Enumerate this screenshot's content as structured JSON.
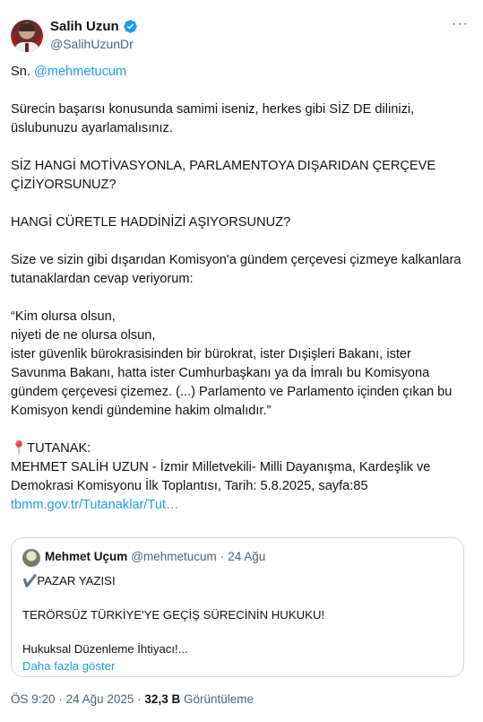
{
  "author": {
    "display_name": "Salih Uzun",
    "handle": "@SalihUzunDr",
    "more_icon": "···"
  },
  "tweet": {
    "salutation_prefix": "Sn. ",
    "salutation_mention": "@mehmetucum",
    "p1": "Sürecin başarısı konusunda samimi iseniz, herkes gibi SİZ DE dilinizi, üslubunuzu ayarlamalısınız.",
    "p2": "SİZ HANGİ MOTİVASYONLA, PARLAMENTOYA DIŞARIDAN ÇERÇEVE ÇİZİYORSUNUZ?",
    "p3": "HANGİ CÜRETLE HADDİNİZİ AŞIYORSUNUZ?",
    "p4": "Size ve sizin gibi dışarıdan Komisyon'a gündem çerçevesi çizmeye kalkanlara tutanaklardan cevap veriyorum:",
    "quote_l1": "“Kim olursa olsun,",
    "quote_l2": "niyeti de ne olursa olsun,",
    "quote_l3": "ister güvenlik bürokrasisinden bir bürokrat, ister Dışişleri Bakanı, ister Savunma Bakanı, hatta ister Cumhurbaşkanı ya da İmralı bu Komisyona gündem çerçevesi çizemez. (...) Parlamento ve Parlamento içinden çıkan bu Komisyon kendi gündemine hakim olmalıdır.”",
    "tutanak_emoji": "📍",
    "tutanak_label": "TUTANAK:",
    "tutanak_body": "MEHMET SALİH UZUN - İzmir Milletvekili- Milli Dayanışma, Kardeşlik ve Demokrasi Komisyonu İlk Toplantısı, Tarih: 5.8.2025, sayfa:85",
    "link": "tbmm.gov.tr/Tutanaklar/Tut…"
  },
  "quoted": {
    "display_name": "Mehmet Uçum",
    "handle": "@mehmetucum",
    "separator": "·",
    "date": "24 Ağu",
    "line1": "✔️PAZAR YAZISI",
    "line2": "TERÖRSÜZ TÜRKİYE'YE GEÇİŞ SÜRECİNİN HUKUKU!",
    "line3": "Hukuksal Düzenleme İhtiyacı!...",
    "show_more": "Daha fazla göster"
  },
  "footer": {
    "time": "ÖS 9:20",
    "separator": "·",
    "date": "24 Ağu 2025",
    "views_count": "32,3 B",
    "views_label": "Görüntüleme"
  },
  "colors": {
    "accent": "#1d9bf0",
    "text": "#0f1419",
    "muted": "#536471",
    "border": "#cfd9de"
  }
}
